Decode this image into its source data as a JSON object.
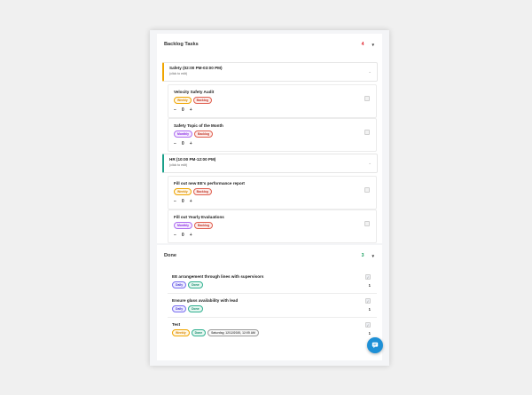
{
  "backlog": {
    "title": "Backlog Tasks",
    "count": "4",
    "caret": "▼",
    "groups": [
      {
        "title": "Safety (02:00 PM-03:00 PM)",
        "subtitle": "(click to edit)",
        "accent": "#f0a500",
        "tasks": [
          {
            "title": "Velocity Safety Audit",
            "tags": [
              "Weekly",
              "Backlog"
            ],
            "qty": "0"
          },
          {
            "title": "Safety Topic of the Month",
            "tags": [
              "Monthly",
              "Backlog"
            ],
            "qty": "0"
          }
        ]
      },
      {
        "title": "HR (10:00 PM-12:00 PM)",
        "subtitle": "(click to edit)",
        "accent": "#1aa08a",
        "tasks": [
          {
            "title": "Fill out new EE's performance report",
            "tags": [
              "Weekly",
              "Backlog"
            ],
            "qty": "0"
          },
          {
            "title": "Fill out Yearly Evaluations",
            "tags": [
              "Monthly",
              "Backlog"
            ],
            "qty": "0"
          }
        ]
      }
    ]
  },
  "done": {
    "title": "Done",
    "count": "3",
    "caret": "▼",
    "items": [
      {
        "title": "EE arrangement through lines with supervisors",
        "tags": [
          "Daily",
          "Done"
        ],
        "count": "1"
      },
      {
        "title": "Ensure glass availability with lead",
        "tags": [
          "Daily",
          "Done"
        ],
        "count": "1"
      },
      {
        "title": "Test",
        "tags": [
          "Weekly",
          "Done",
          "Saturday, 12/12/2020, 12:05 AM"
        ],
        "count": "1"
      }
    ]
  },
  "stepper": {
    "minus": "−",
    "plus": "+"
  },
  "icons": {
    "collapse": "chevron-down-icon",
    "fab": "chat-icon",
    "check": "check-icon"
  },
  "colors": {
    "fab": "#1e90d6",
    "backlog_count": "#e0202a",
    "done_count": "#1aa060"
  }
}
